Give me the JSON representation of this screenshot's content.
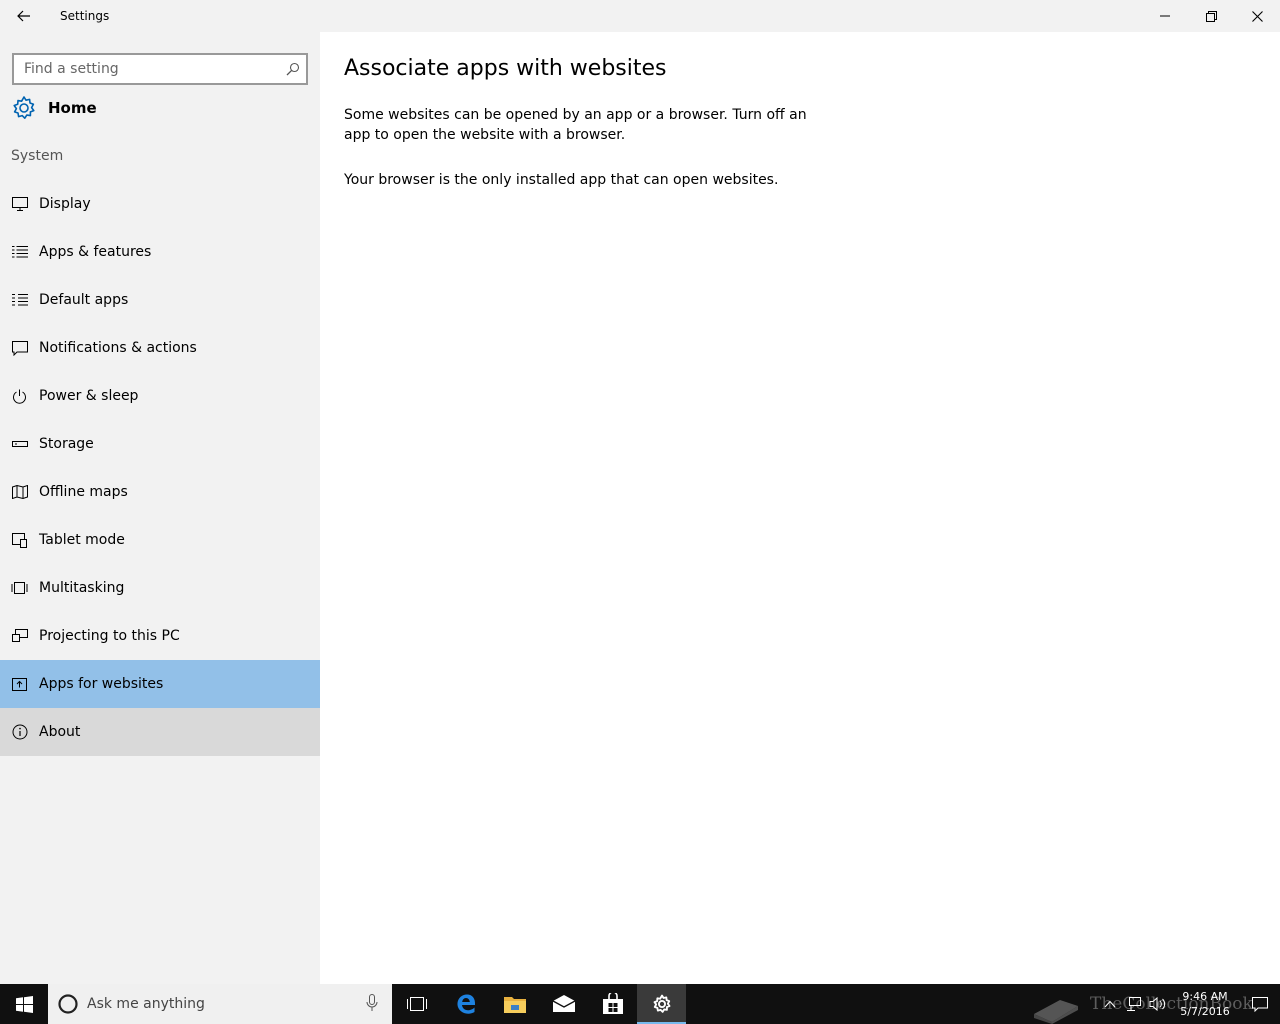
{
  "window": {
    "title": "Settings"
  },
  "sidebar": {
    "search_placeholder": "Find a setting",
    "home_label": "Home",
    "section": "System",
    "items": [
      {
        "label": "Display",
        "icon": "display-icon"
      },
      {
        "label": "Apps & features",
        "icon": "apps-features-icon"
      },
      {
        "label": "Default apps",
        "icon": "default-apps-icon"
      },
      {
        "label": "Notifications & actions",
        "icon": "notifications-icon"
      },
      {
        "label": "Power & sleep",
        "icon": "power-icon"
      },
      {
        "label": "Storage",
        "icon": "storage-icon"
      },
      {
        "label": "Offline maps",
        "icon": "map-icon"
      },
      {
        "label": "Tablet mode",
        "icon": "tablet-icon"
      },
      {
        "label": "Multitasking",
        "icon": "multitasking-icon"
      },
      {
        "label": "Projecting to this PC",
        "icon": "projecting-icon"
      },
      {
        "label": "Apps for websites",
        "icon": "apps-websites-icon",
        "selected": true
      },
      {
        "label": "About",
        "icon": "info-icon"
      }
    ]
  },
  "main": {
    "title": "Associate apps with websites",
    "description": "Some websites can be opened by an app or a browser.  Turn off an app to open the website with a browser.",
    "info": "Your browser is the only installed app that can open websites."
  },
  "taskbar": {
    "search_placeholder": "Ask me anything",
    "time": "9:46 AM",
    "date": "5/7/2016",
    "watermark": "TheCollectionBook"
  },
  "colors": {
    "accent": "#0063b1",
    "selected_bg": "#92c0e8",
    "sidebar_bg": "#f2f2f2",
    "taskbar_bg": "#101010"
  }
}
